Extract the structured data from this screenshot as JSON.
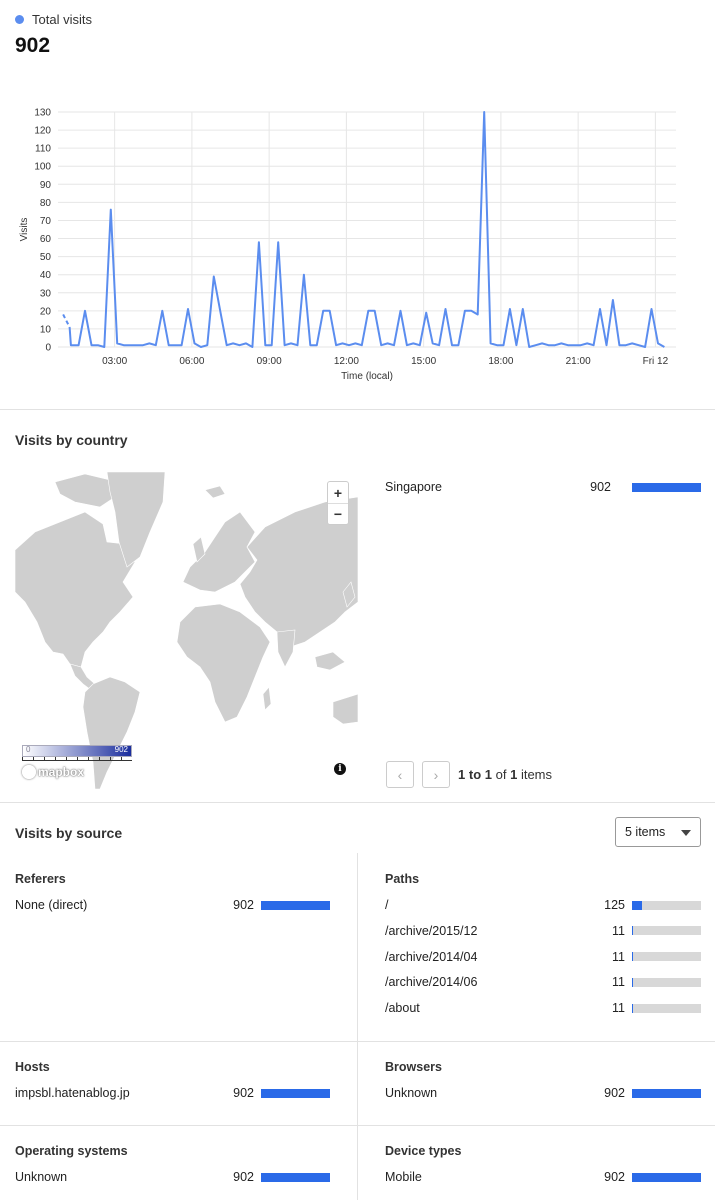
{
  "summary": {
    "legend_label": "Total visits",
    "total": "902",
    "accent": "#5b8def"
  },
  "chart_data": {
    "type": "line",
    "xlabel": "Time (local)",
    "ylabel": "Visits",
    "ylim": [
      0,
      130
    ],
    "yticks": [
      0,
      10,
      20,
      30,
      40,
      50,
      60,
      70,
      80,
      90,
      100,
      110,
      120,
      130
    ],
    "xlim_hours": [
      0.8,
      24.8
    ],
    "xticks": [
      {
        "h": 3,
        "label": "03:00"
      },
      {
        "h": 6,
        "label": "06:00"
      },
      {
        "h": 9,
        "label": "09:00"
      },
      {
        "h": 12,
        "label": "12:00"
      },
      {
        "h": 15,
        "label": "15:00"
      },
      {
        "h": 18,
        "label": "18:00"
      },
      {
        "h": 21,
        "label": "21:00"
      },
      {
        "h": 24,
        "label": "Fri 12"
      }
    ],
    "dashed_segment": [
      [
        1.0,
        18
      ],
      [
        1.25,
        11
      ]
    ],
    "series": [
      {
        "color": "#5b8def",
        "points": [
          [
            1.25,
            11
          ],
          [
            1.3,
            1
          ],
          [
            1.6,
            1
          ],
          [
            1.85,
            20
          ],
          [
            2.1,
            1
          ],
          [
            2.35,
            1
          ],
          [
            2.6,
            0
          ],
          [
            2.85,
            76
          ],
          [
            3.1,
            2
          ],
          [
            3.35,
            1
          ],
          [
            3.6,
            1
          ],
          [
            3.85,
            1
          ],
          [
            4.1,
            1
          ],
          [
            4.35,
            2
          ],
          [
            4.6,
            1
          ],
          [
            4.85,
            20
          ],
          [
            5.1,
            1
          ],
          [
            5.35,
            1
          ],
          [
            5.6,
            1
          ],
          [
            5.85,
            21
          ],
          [
            6.1,
            2
          ],
          [
            6.35,
            0
          ],
          [
            6.6,
            1
          ],
          [
            6.85,
            39
          ],
          [
            7.1,
            20
          ],
          [
            7.35,
            1
          ],
          [
            7.6,
            2
          ],
          [
            7.85,
            1
          ],
          [
            8.1,
            2
          ],
          [
            8.35,
            0
          ],
          [
            8.6,
            58
          ],
          [
            8.85,
            1
          ],
          [
            9.1,
            1
          ],
          [
            9.35,
            58
          ],
          [
            9.6,
            1
          ],
          [
            9.85,
            2
          ],
          [
            10.1,
            1
          ],
          [
            10.35,
            40
          ],
          [
            10.6,
            1
          ],
          [
            10.85,
            1
          ],
          [
            11.1,
            20
          ],
          [
            11.35,
            20
          ],
          [
            11.6,
            1
          ],
          [
            11.85,
            2
          ],
          [
            12.1,
            1
          ],
          [
            12.35,
            2
          ],
          [
            12.6,
            1
          ],
          [
            12.85,
            20
          ],
          [
            13.1,
            20
          ],
          [
            13.35,
            1
          ],
          [
            13.6,
            2
          ],
          [
            13.85,
            1
          ],
          [
            14.1,
            20
          ],
          [
            14.35,
            1
          ],
          [
            14.6,
            2
          ],
          [
            14.85,
            1
          ],
          [
            15.1,
            19
          ],
          [
            15.35,
            2
          ],
          [
            15.6,
            1
          ],
          [
            15.85,
            21
          ],
          [
            16.1,
            1
          ],
          [
            16.35,
            1
          ],
          [
            16.6,
            20
          ],
          [
            16.85,
            20
          ],
          [
            17.1,
            18
          ],
          [
            17.35,
            130
          ],
          [
            17.6,
            2
          ],
          [
            17.85,
            1
          ],
          [
            18.1,
            1
          ],
          [
            18.35,
            21
          ],
          [
            18.6,
            1
          ],
          [
            18.85,
            21
          ],
          [
            19.1,
            0
          ],
          [
            19.35,
            1
          ],
          [
            19.6,
            2
          ],
          [
            19.85,
            1
          ],
          [
            20.1,
            1
          ],
          [
            20.35,
            2
          ],
          [
            20.6,
            1
          ],
          [
            20.85,
            1
          ],
          [
            21.1,
            1
          ],
          [
            21.35,
            2
          ],
          [
            21.6,
            1
          ],
          [
            21.85,
            21
          ],
          [
            22.1,
            1
          ],
          [
            22.35,
            26
          ],
          [
            22.6,
            1
          ],
          [
            22.85,
            1
          ],
          [
            23.1,
            2
          ],
          [
            23.35,
            1
          ],
          [
            23.6,
            0
          ],
          [
            23.85,
            21
          ],
          [
            24.1,
            2
          ],
          [
            24.35,
            0
          ]
        ]
      }
    ]
  },
  "country": {
    "title": "Visits by country",
    "zoom_in": "+",
    "zoom_out": "−",
    "scale_min": "0",
    "scale_max": "902",
    "mapbox_label": "mapbox",
    "info_icon": "i",
    "rows": [
      {
        "label": "Singapore",
        "value": "902",
        "fraction": 1.0
      }
    ],
    "pagination": {
      "prev": "‹",
      "next": "›",
      "from": "1",
      "to_word": "to",
      "to": "1",
      "of_word": "of",
      "total": "1",
      "items_word": "items"
    }
  },
  "source": {
    "title": "Visits by source",
    "select_value": "5 items",
    "referers": {
      "title": "Referers",
      "rows": [
        {
          "label": "None (direct)",
          "value": "902",
          "fraction": 1.0
        }
      ]
    },
    "paths": {
      "title": "Paths",
      "rows": [
        {
          "label": "/",
          "value": "125",
          "fraction": 0.139
        },
        {
          "label": "/archive/2015/12",
          "value": "11",
          "fraction": 0.012
        },
        {
          "label": "/archive/2014/04",
          "value": "11",
          "fraction": 0.012
        },
        {
          "label": "/archive/2014/06",
          "value": "11",
          "fraction": 0.012
        },
        {
          "label": "/about",
          "value": "11",
          "fraction": 0.012
        }
      ]
    },
    "hosts": {
      "title": "Hosts",
      "rows": [
        {
          "label": "impsbl.hatenablog.jp",
          "value": "902",
          "fraction": 1.0
        }
      ]
    },
    "browsers": {
      "title": "Browsers",
      "rows": [
        {
          "label": "Unknown",
          "value": "902",
          "fraction": 1.0
        }
      ]
    },
    "os": {
      "title": "Operating systems",
      "rows": [
        {
          "label": "Unknown",
          "value": "902",
          "fraction": 1.0
        }
      ]
    },
    "devices": {
      "title": "Device types",
      "rows": [
        {
          "label": "Mobile",
          "value": "902",
          "fraction": 1.0
        }
      ]
    }
  }
}
